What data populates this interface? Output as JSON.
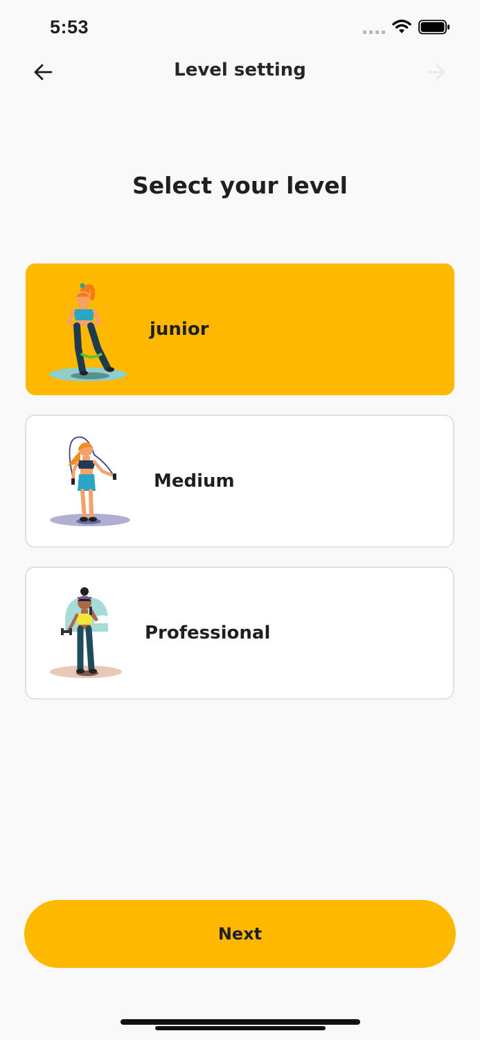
{
  "status_bar": {
    "time": "5:53"
  },
  "nav": {
    "title": "Level setting"
  },
  "heading": "Select your level",
  "levels": [
    {
      "label": "junior",
      "selected": true
    },
    {
      "label": "Medium",
      "selected": false
    },
    {
      "label": "Professional",
      "selected": false
    }
  ],
  "actions": {
    "next_label": "Next"
  },
  "colors": {
    "accent": "#ffb800",
    "background": "#f9f9f9",
    "card": "#ffffff",
    "card_border": "#e1e1e1",
    "text": "#1f1f1f"
  },
  "icons": {
    "back": "arrow-left-icon",
    "forward": "arrow-right-icon",
    "wifi": "wifi-icon",
    "battery": "battery-icon",
    "signal": "signal-dots-icon",
    "junior": "resistance-band-woman-illustration",
    "medium": "jump-rope-woman-illustration",
    "professional": "dumbbell-woman-illustration"
  }
}
